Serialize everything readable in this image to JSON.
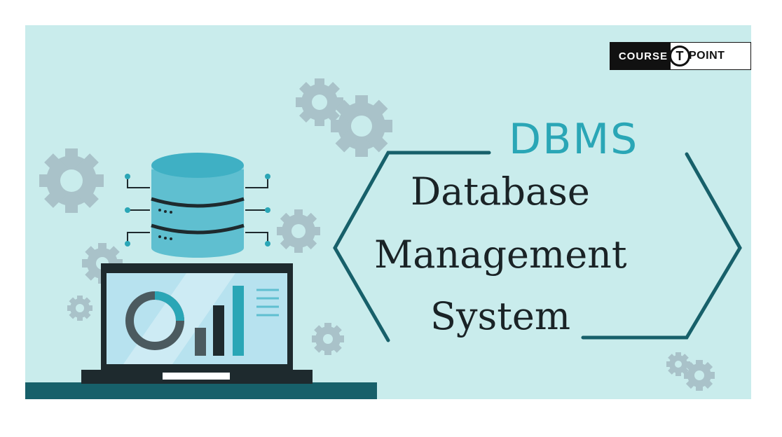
{
  "colors": {
    "background": "#c9ecec",
    "accent": "#2aa6b6",
    "frame": "#17606a",
    "gear": "#a9c2c9",
    "dark": "#1e2a2e"
  },
  "logo": {
    "left_text": "COURSE",
    "mark": "T",
    "right_text": "POINT"
  },
  "heading": {
    "acronym": "DBMS",
    "line1": "Database",
    "line2": "Management",
    "line3": "System"
  },
  "icons": [
    "gear-icon",
    "database-icon",
    "laptop-icon",
    "donut-chart-icon",
    "bar-chart-icon"
  ]
}
